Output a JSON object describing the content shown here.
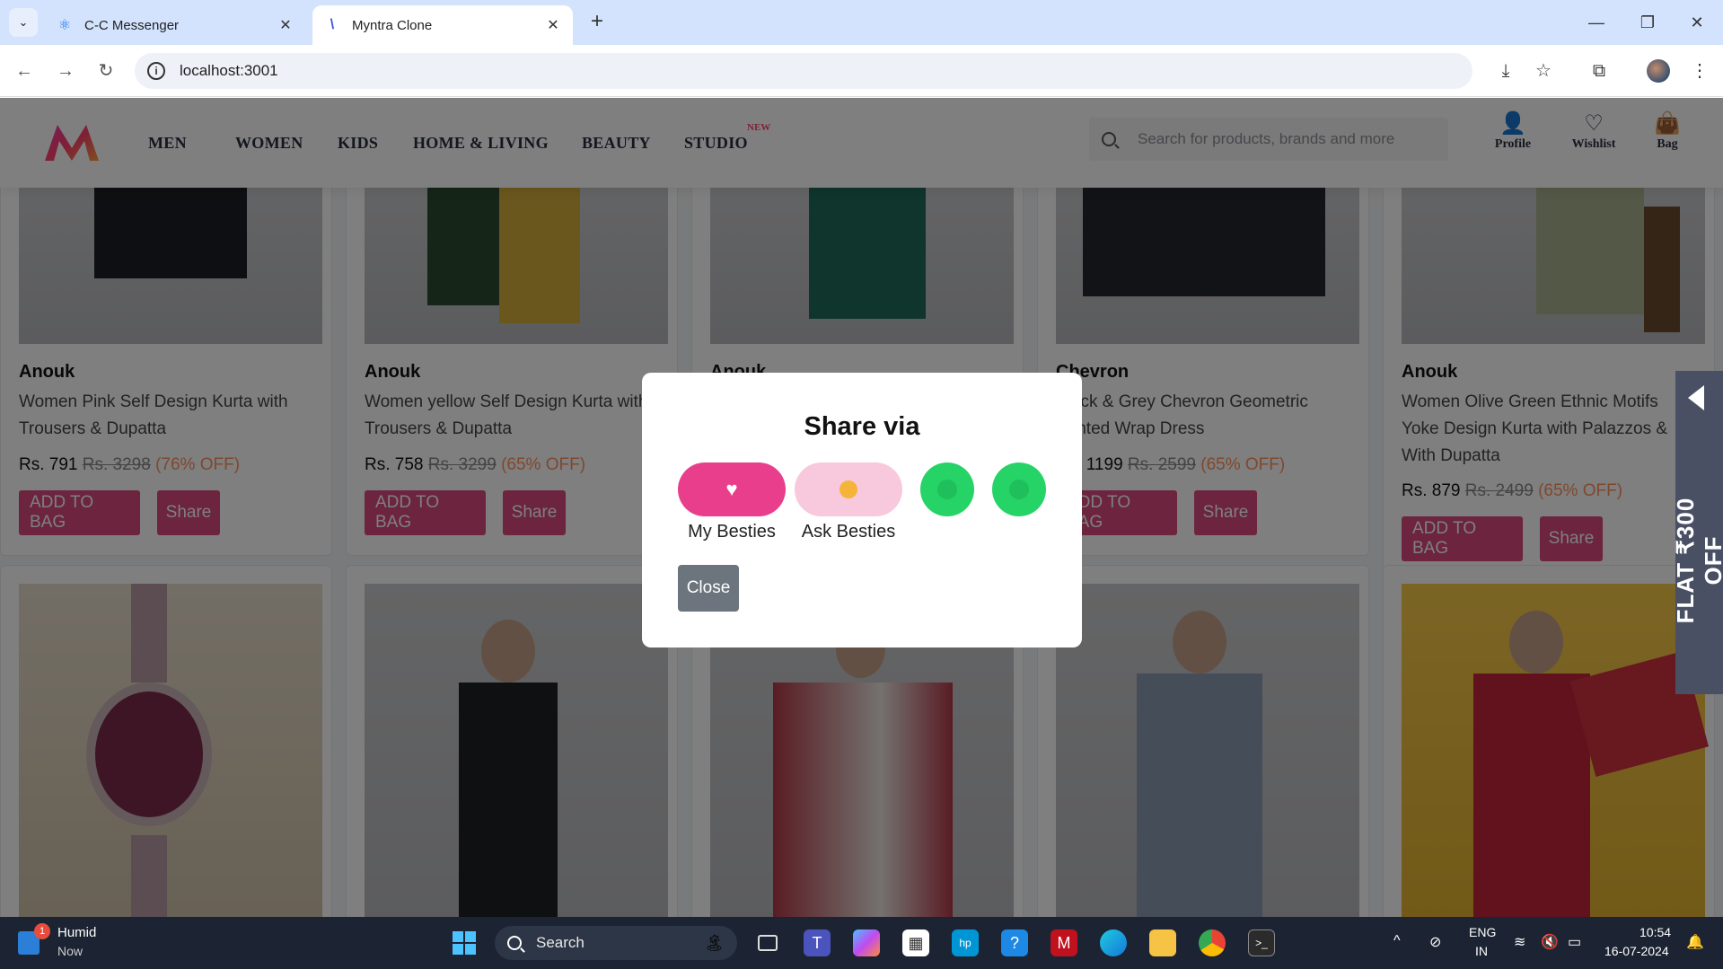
{
  "browser": {
    "tabs": [
      {
        "title": "C-C Messenger"
      },
      {
        "title": "Myntra Clone"
      }
    ],
    "url": "localhost:3001"
  },
  "header": {
    "nav": [
      "MEN",
      "WOMEN",
      "KIDS",
      "HOME & LIVING",
      "BEAUTY",
      "STUDIO"
    ],
    "studio_badge": "NEW",
    "search_placeholder": "Search for products, brands and more",
    "actions": [
      "Profile",
      "Wishlist",
      "Bag"
    ]
  },
  "products_row1": [
    {
      "brand": "Anouk",
      "name": "Women Pink Self Design Kurta with Trousers & Dupatta",
      "price": "Rs. 791",
      "mrp": "Rs. 3298",
      "discount": "(76% OFF)"
    },
    {
      "brand": "Anouk",
      "name": "Women yellow Self Design Kurta with Trousers & Dupatta",
      "price": "Rs. 758",
      "mrp": "Rs. 3299",
      "discount": "(65% OFF)"
    },
    {
      "brand": "Anouk",
      "name": "",
      "price": "",
      "mrp": "",
      "discount": ""
    },
    {
      "brand": "Chevron",
      "name": "Black & Grey Chevron Geometric Printed Wrap Dress",
      "price": "Rs. 1199",
      "mrp": "Rs. 2599",
      "discount": "(65% OFF)"
    },
    {
      "brand": "Anouk",
      "name": "Women Olive Green Ethnic Motifs Yoke Design Kurta with Palazzos & With Dupatta",
      "price": "Rs. 879",
      "mrp": "Rs. 2499",
      "discount": "(65% OFF)"
    }
  ],
  "buttons": {
    "add_to_bag": "ADD TO BAG",
    "share": "Share"
  },
  "promo": "FLAT ₹300 OFF",
  "modal": {
    "title": "Share via",
    "options": [
      {
        "label": "My Besties",
        "color": "#e83e8c"
      },
      {
        "label": "Ask Besties",
        "color": "#f8c8dc"
      }
    ],
    "whatsapp_color": "#25d366",
    "close": "Close"
  },
  "taskbar": {
    "notification": {
      "badge": "1",
      "title": "Humid",
      "subtitle": "Now"
    },
    "search_label": "Search",
    "lang": [
      "ENG",
      "IN"
    ],
    "time": "10:54",
    "date": "16-07-2024"
  }
}
